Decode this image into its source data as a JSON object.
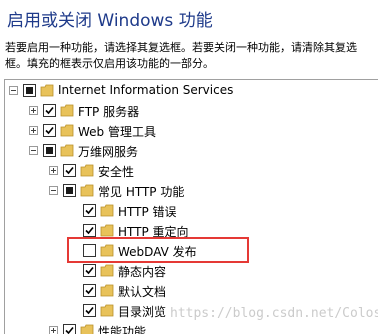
{
  "window": {
    "title": "启用或关闭 Windows 功能",
    "description": "若要启用一种功能，请选择其复选框。若要关闭一种功能，请清除其复选框。填充的框表示仅启用该功能的一部分。"
  },
  "tree": {
    "items": [
      {
        "label": "Internet Information Services",
        "state": "partial",
        "expander": "minus"
      },
      {
        "label": "FTP 服务器",
        "state": "checked",
        "expander": "plus"
      },
      {
        "label": "Web 管理工具",
        "state": "checked",
        "expander": "plus"
      },
      {
        "label": "万维网服务",
        "state": "partial",
        "expander": "minus"
      },
      {
        "label": "安全性",
        "state": "checked",
        "expander": "plus"
      },
      {
        "label": "常见 HTTP 功能",
        "state": "partial",
        "expander": "minus"
      },
      {
        "label": "HTTP 错误",
        "state": "checked",
        "expander": "none"
      },
      {
        "label": "HTTP 重定向",
        "state": "checked",
        "expander": "none"
      },
      {
        "label": "WebDAV 发布",
        "state": "unchecked",
        "expander": "none"
      },
      {
        "label": "静态内容",
        "state": "checked",
        "expander": "none"
      },
      {
        "label": "默认文档",
        "state": "checked",
        "expander": "none"
      },
      {
        "label": "目录浏览",
        "state": "checked",
        "expander": "none"
      },
      {
        "label": "性能功能",
        "state": "checked",
        "expander": "plus"
      }
    ]
  },
  "watermark": "https://blog.csdn.net/Colossalis_c",
  "colors": {
    "title": "#1e3a8a",
    "highlight": "#e53935",
    "folder": "#e8c25a"
  }
}
